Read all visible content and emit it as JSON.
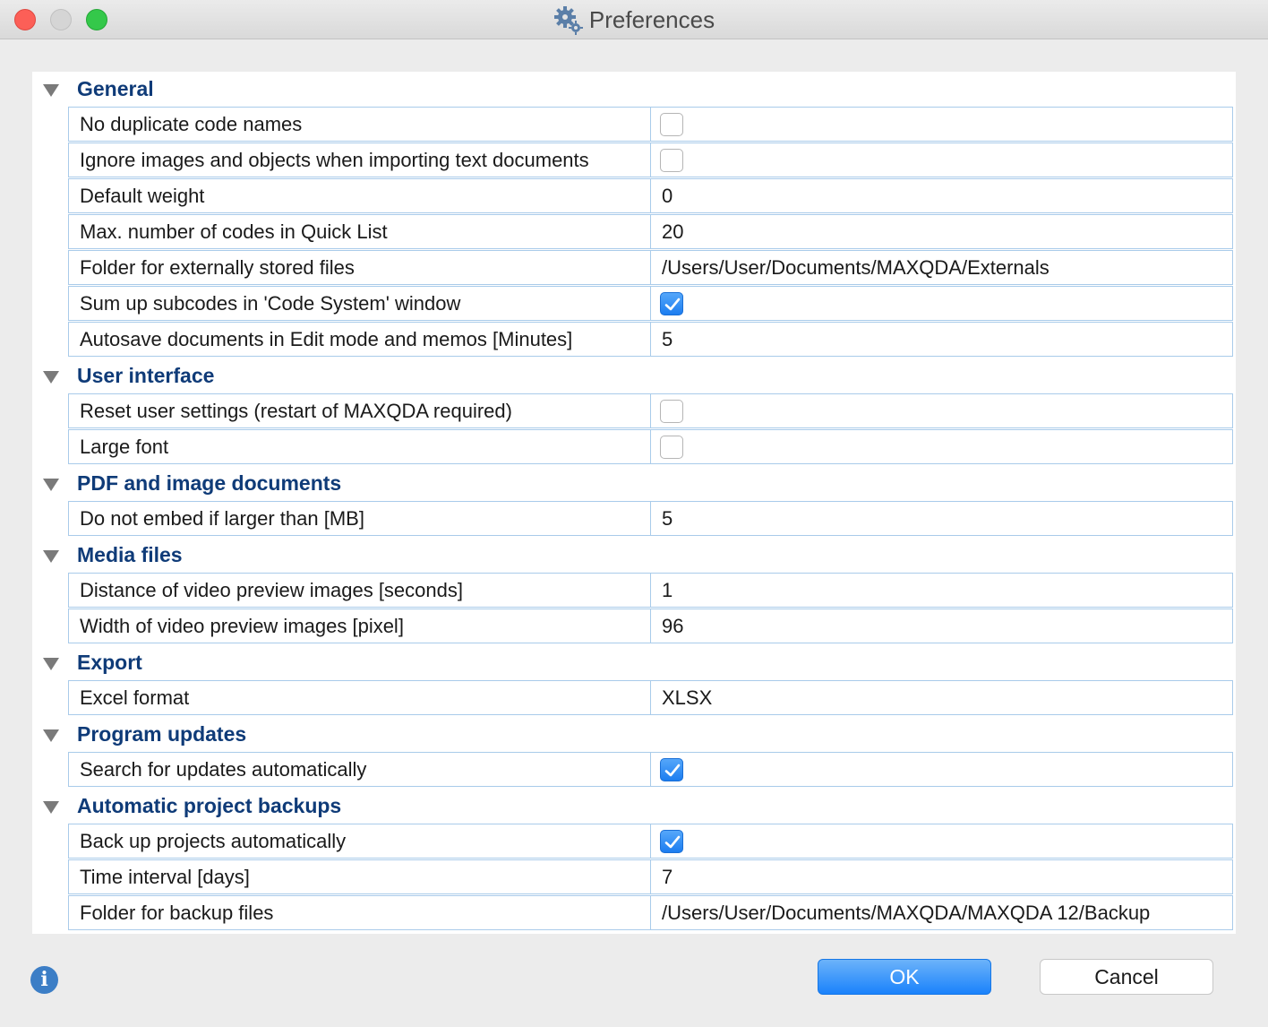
{
  "window": {
    "title": "Preferences",
    "title_icon": "gear-icon"
  },
  "sections": [
    {
      "title": "General",
      "rows": [
        {
          "label": "No duplicate code names",
          "type": "checkbox",
          "checked": false
        },
        {
          "label": "Ignore images and objects when importing text documents",
          "type": "checkbox",
          "checked": false
        },
        {
          "label": "Default weight",
          "type": "text",
          "value": "0"
        },
        {
          "label": "Max. number of codes in Quick List",
          "type": "text",
          "value": "20"
        },
        {
          "label": "Folder for externally stored files",
          "type": "text",
          "value": "/Users/User/Documents/MAXQDA/Externals"
        },
        {
          "label": "Sum up subcodes in 'Code System' window",
          "type": "checkbox",
          "checked": true
        },
        {
          "label": "Autosave documents in Edit mode and memos [Minutes]",
          "type": "text",
          "value": "5"
        }
      ]
    },
    {
      "title": "User interface",
      "rows": [
        {
          "label": "Reset user settings (restart of MAXQDA required)",
          "type": "checkbox",
          "checked": false
        },
        {
          "label": "Large font",
          "type": "checkbox",
          "checked": false
        }
      ]
    },
    {
      "title": "PDF and image documents",
      "rows": [
        {
          "label": "Do not embed if larger than [MB]",
          "type": "text",
          "value": "5"
        }
      ]
    },
    {
      "title": "Media files",
      "rows": [
        {
          "label": "Distance of video preview images [seconds]",
          "type": "text",
          "value": "1"
        },
        {
          "label": "Width of video preview images [pixel]",
          "type": "text",
          "value": "96"
        }
      ]
    },
    {
      "title": "Export",
      "rows": [
        {
          "label": "Excel format",
          "type": "text",
          "value": "XLSX"
        }
      ]
    },
    {
      "title": "Program updates",
      "rows": [
        {
          "label": "Search for updates automatically",
          "type": "checkbox",
          "checked": true
        }
      ]
    },
    {
      "title": "Automatic project backups",
      "rows": [
        {
          "label": "Back up projects automatically",
          "type": "checkbox",
          "checked": true
        },
        {
          "label": "Time interval [days]",
          "type": "text",
          "value": "7"
        },
        {
          "label": "Folder for backup files",
          "type": "text",
          "value": "/Users/User/Documents/MAXQDA/MAXQDA 12/Backup"
        }
      ]
    }
  ],
  "footer": {
    "info_icon": "info-icon",
    "ok_label": "OK",
    "cancel_label": "Cancel"
  },
  "colors": {
    "section_title": "#0f3b78",
    "grid_border": "#a9cbea",
    "accent": "#1a82fb"
  }
}
